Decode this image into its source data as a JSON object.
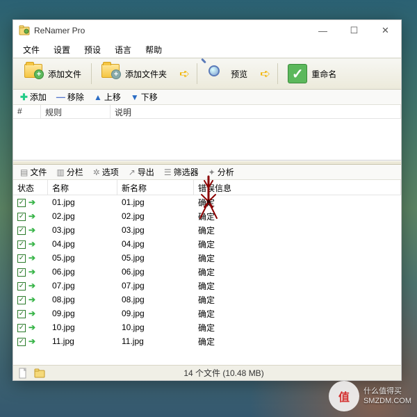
{
  "app": {
    "title": "ReNamer Pro"
  },
  "window_controls": {
    "min": "—",
    "max": "☐",
    "close": "✕"
  },
  "menu": [
    "文件",
    "设置",
    "预设",
    "语言",
    "帮助"
  ],
  "toolbar": {
    "add_file": "添加文件",
    "add_folder": "添加文件夹",
    "preview": "预览",
    "rename": "重命名"
  },
  "rules_toolbar": {
    "add": "添加",
    "remove": "移除",
    "up": "上移",
    "down": "下移"
  },
  "rules_headers": {
    "num": "#",
    "rule": "规则",
    "desc": "说明"
  },
  "files_toolbar": [
    "文件",
    "分栏",
    "选项",
    "导出",
    "筛选器",
    "分析"
  ],
  "files_headers": {
    "status": "状态",
    "name": "名称",
    "newname": "新名称",
    "err": "错误信息"
  },
  "files": [
    {
      "name": "01.jpg",
      "newname": "01.jpg",
      "err": "确定"
    },
    {
      "name": "02.jpg",
      "newname": "02.jpg",
      "err": "确定"
    },
    {
      "name": "03.jpg",
      "newname": "03.jpg",
      "err": "确定"
    },
    {
      "name": "04.jpg",
      "newname": "04.jpg",
      "err": "确定"
    },
    {
      "name": "05.jpg",
      "newname": "05.jpg",
      "err": "确定"
    },
    {
      "name": "06.jpg",
      "newname": "06.jpg",
      "err": "确定"
    },
    {
      "name": "07.jpg",
      "newname": "07.jpg",
      "err": "确定"
    },
    {
      "name": "08.jpg",
      "newname": "08.jpg",
      "err": "确定"
    },
    {
      "name": "09.jpg",
      "newname": "09.jpg",
      "err": "确定"
    },
    {
      "name": "10.jpg",
      "newname": "10.jpg",
      "err": "确定"
    },
    {
      "name": "11.jpg",
      "newname": "11.jpg",
      "err": "确定"
    }
  ],
  "statusbar": {
    "text": "14 个文件 (10.48 MB)"
  },
  "watermark": {
    "badge": "值",
    "line1": "什么值得买",
    "line2": "SMZDM.COM"
  }
}
